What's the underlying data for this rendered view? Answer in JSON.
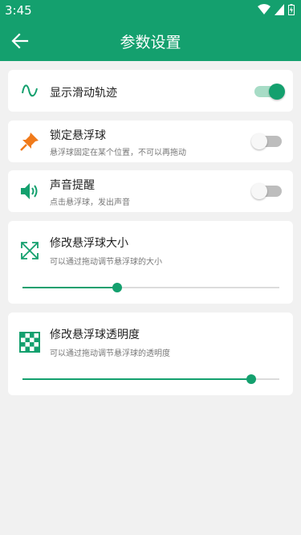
{
  "status": {
    "time": "3:45"
  },
  "appbar": {
    "title": "参数设置"
  },
  "settings": [
    {
      "title": "显示滑动轨迹",
      "subtitle": "",
      "enabled": true,
      "icon": "wave-icon"
    },
    {
      "title": "锁定悬浮球",
      "subtitle": "悬浮球固定在某个位置，不可以再拖动",
      "enabled": false,
      "icon": "pin-icon"
    },
    {
      "title": "声音提醒",
      "subtitle": "点击悬浮球，发出声音",
      "enabled": false,
      "icon": "speaker-icon"
    }
  ],
  "sliders": [
    {
      "title": "修改悬浮球大小",
      "subtitle": "可以通过拖动调节悬浮球的大小",
      "value": 0.37,
      "icon": "resize-icon"
    },
    {
      "title": "修改悬浮球透明度",
      "subtitle": "可以通过拖动调节悬浮球的透明度",
      "value": 0.89,
      "icon": "checker-icon"
    }
  ],
  "colors": {
    "accent": "#14a06e",
    "pin": "#f07a1a"
  }
}
